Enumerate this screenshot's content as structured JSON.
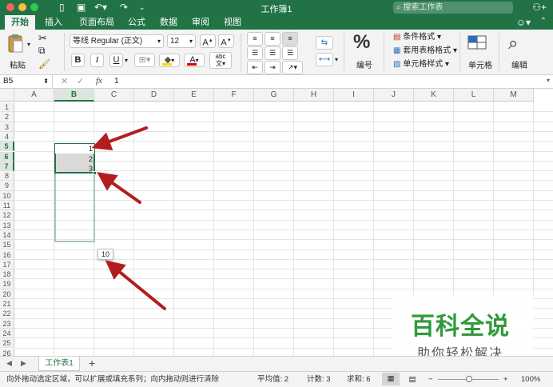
{
  "window": {
    "title": "工作簿1",
    "search_placeholder": "搜索工作表"
  },
  "tabs": [
    "开始",
    "插入",
    "页面布局",
    "公式",
    "数据",
    "审阅",
    "视图"
  ],
  "ribbon": {
    "paste_label": "粘贴",
    "font_name": "等线 Regular (正文)",
    "font_size": "12",
    "grow_font": "A",
    "shrink_font": "A",
    "bold": "B",
    "italic": "I",
    "underline": "U",
    "font_color_glyph": "A",
    "phonetic": "abc",
    "number_symbol": "%",
    "number_label": "编号",
    "conditional_format": "条件格式",
    "table_format": "套用表格格式",
    "cell_styles": "单元格样式",
    "cells_label": "单元格",
    "editing_label": "编辑"
  },
  "formula_bar": {
    "name_box": "B5",
    "fx": "fx",
    "value": "1"
  },
  "columns": [
    "A",
    "B",
    "C",
    "D",
    "E",
    "F",
    "G",
    "H",
    "I",
    "J",
    "K",
    "L",
    "M"
  ],
  "rows": [
    "1",
    "2",
    "3",
    "4",
    "5",
    "6",
    "7",
    "8",
    "9",
    "10",
    "11",
    "12",
    "13",
    "14",
    "15",
    "16",
    "17",
    "18",
    "19",
    "20",
    "21",
    "22",
    "23",
    "24",
    "25",
    "26"
  ],
  "cells": {
    "B5": "1",
    "B6": "2",
    "B7": "3"
  },
  "fill_tooltip": "10",
  "sheet_tabs": [
    "工作表1"
  ],
  "status": {
    "message": "向外拖动选定区域，可以扩展或填充系列；向内拖动则进行清除",
    "average": "平均值: 2",
    "count": "计数: 3",
    "sum": "求和: 6",
    "zoom": "100%"
  },
  "watermark": {
    "title": "百科全说",
    "subtitle": "助你轻松解决"
  },
  "colors": {
    "accent": "#217346",
    "arrow": "#b31d1d",
    "selection_fill": "#d9d9d9",
    "watermark_green": "#2f9a3a"
  }
}
